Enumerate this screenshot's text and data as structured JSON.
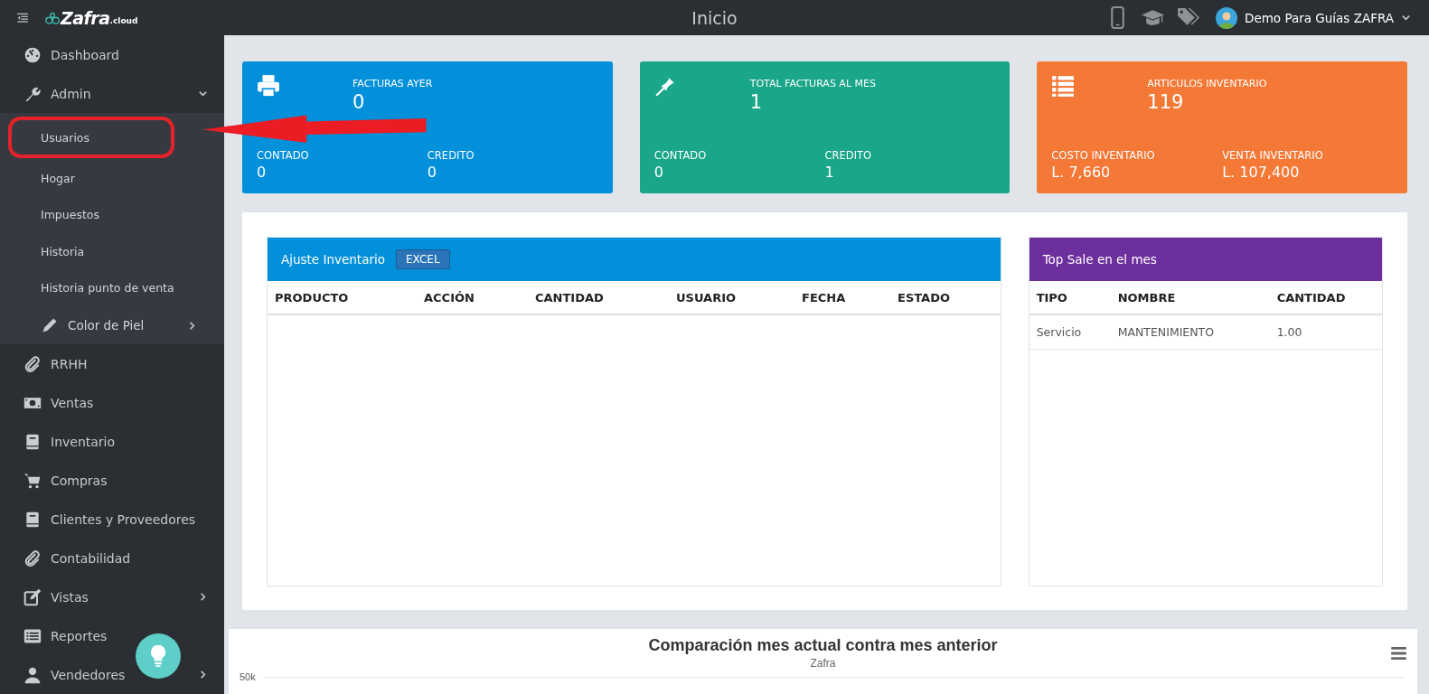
{
  "topbar": {
    "logo": "Zafra",
    "logo_suffix": ".cloud",
    "title": "Inicio",
    "user": "Demo Para Guías ZAFRA"
  },
  "sidebar": {
    "items": [
      {
        "label": "Dashboard"
      },
      {
        "label": "Admin",
        "expanded": true,
        "has_children": true,
        "children": [
          {
            "label": "Usuarios",
            "highlighted": true
          },
          {
            "label": "Hogar",
            "highlighted": false
          },
          {
            "label": "Impuestos",
            "highlighted": false
          },
          {
            "label": "Historia",
            "highlighted": false
          },
          {
            "label": "Historia punto de venta",
            "highlighted": false
          },
          {
            "label": "Color de Piel",
            "has_children": true,
            "highlighted": false
          }
        ]
      },
      {
        "label": "RRHH"
      },
      {
        "label": "Ventas"
      },
      {
        "label": "Inventario"
      },
      {
        "label": "Compras"
      },
      {
        "label": "Clientes y Proveedores"
      },
      {
        "label": "Contabilidad"
      },
      {
        "label": "Vistas",
        "expanded": false,
        "has_children": true
      },
      {
        "label": "Reportes"
      },
      {
        "label": "Vendedores",
        "expanded": false,
        "has_children": true
      }
    ]
  },
  "stat_cards": [
    {
      "color": "#0190d9",
      "title": "FACTURAS AYER",
      "value": "0",
      "left_label": "CONTADO",
      "left_value": "0",
      "right_label": "CREDITO",
      "right_value": "0"
    },
    {
      "color": "#19a689",
      "title": "TOTAL FACTURAS AL MES",
      "value": "1",
      "left_label": "CONTADO",
      "left_value": "0",
      "right_label": "CREDITO",
      "right_value": "1"
    },
    {
      "color": "#f47836",
      "title": "ARTICULOS INVENTARIO",
      "value": "119",
      "left_label": "COSTO INVENTARIO",
      "left_value": "L. 7,660",
      "right_label": "VENTA INVENTARIO",
      "right_value": "L. 107,400"
    }
  ],
  "inventory_panel": {
    "title": "Ajuste Inventario",
    "button": "EXCEL",
    "columns": [
      "PRODUCTO",
      "ACCIÓN",
      "CANTIDAD",
      "USUARIO",
      "FECHA",
      "ESTADO"
    ]
  },
  "top_sale_panel": {
    "title": "Top Sale en el mes",
    "columns": [
      "TIPO",
      "NOMBRE",
      "CANTIDAD"
    ],
    "rows": [
      [
        "Servicio",
        "MANTENIMIENTO",
        "1.00"
      ]
    ]
  },
  "chart": {
    "title": "Comparación mes actual contra mes anterior",
    "subtitle": "Zafra",
    "y_tick": "50k"
  }
}
